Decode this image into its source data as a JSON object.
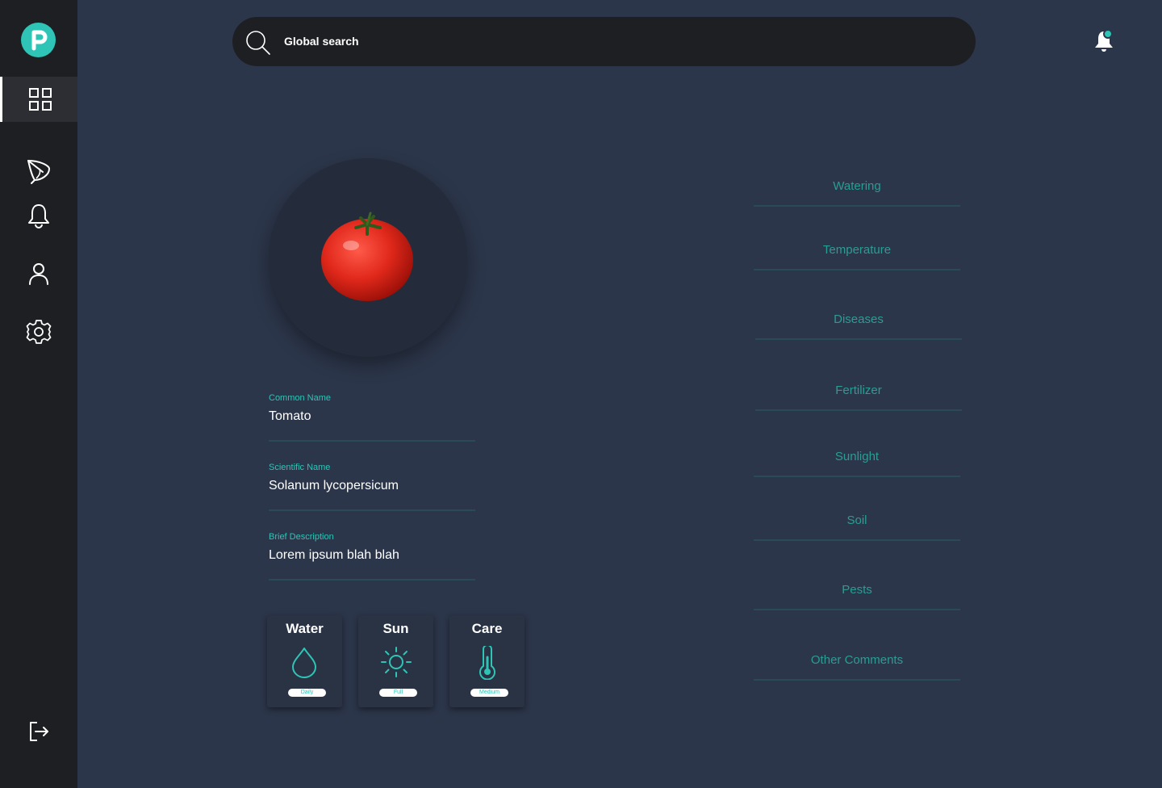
{
  "app": {
    "logo_letter": "P"
  },
  "sidebar": {
    "items": [
      {
        "name": "dashboard",
        "icon": "grid-icon",
        "active": true
      },
      {
        "name": "plants",
        "icon": "leaf-icon"
      },
      {
        "name": "notifications",
        "icon": "bell-icon"
      },
      {
        "name": "profile",
        "icon": "user-icon"
      },
      {
        "name": "settings",
        "icon": "gear-icon"
      },
      {
        "name": "logout",
        "icon": "logout-icon"
      }
    ]
  },
  "search": {
    "placeholder": "Global search"
  },
  "header": {
    "notification_icon": "bell-icon",
    "has_unread": true
  },
  "plant": {
    "image": "tomato",
    "fields": [
      {
        "label": "Common Name",
        "value": "Tomato"
      },
      {
        "label": "Scientific Name",
        "value": "Solanum lycopersicum"
      },
      {
        "label": "Brief Description",
        "value": "Lorem ipsum blah blah"
      }
    ],
    "cards": [
      {
        "title": "Water",
        "icon": "water-drop-icon",
        "level": "Daily"
      },
      {
        "title": "Sun",
        "icon": "sun-icon",
        "level": "Full"
      },
      {
        "title": "Care",
        "icon": "thermometer-icon",
        "level": "Medium"
      }
    ]
  },
  "care_sections": [
    "Watering",
    "Temperature",
    "Diseases",
    "Fertilizer",
    "Sunlight",
    "Soil",
    "Pests",
    "Other Comments"
  ],
  "colors": {
    "accent": "#2ec4b6",
    "background": "#2c364a",
    "sidebar": "#1e1f22",
    "muted_teal": "#2a9d93"
  }
}
